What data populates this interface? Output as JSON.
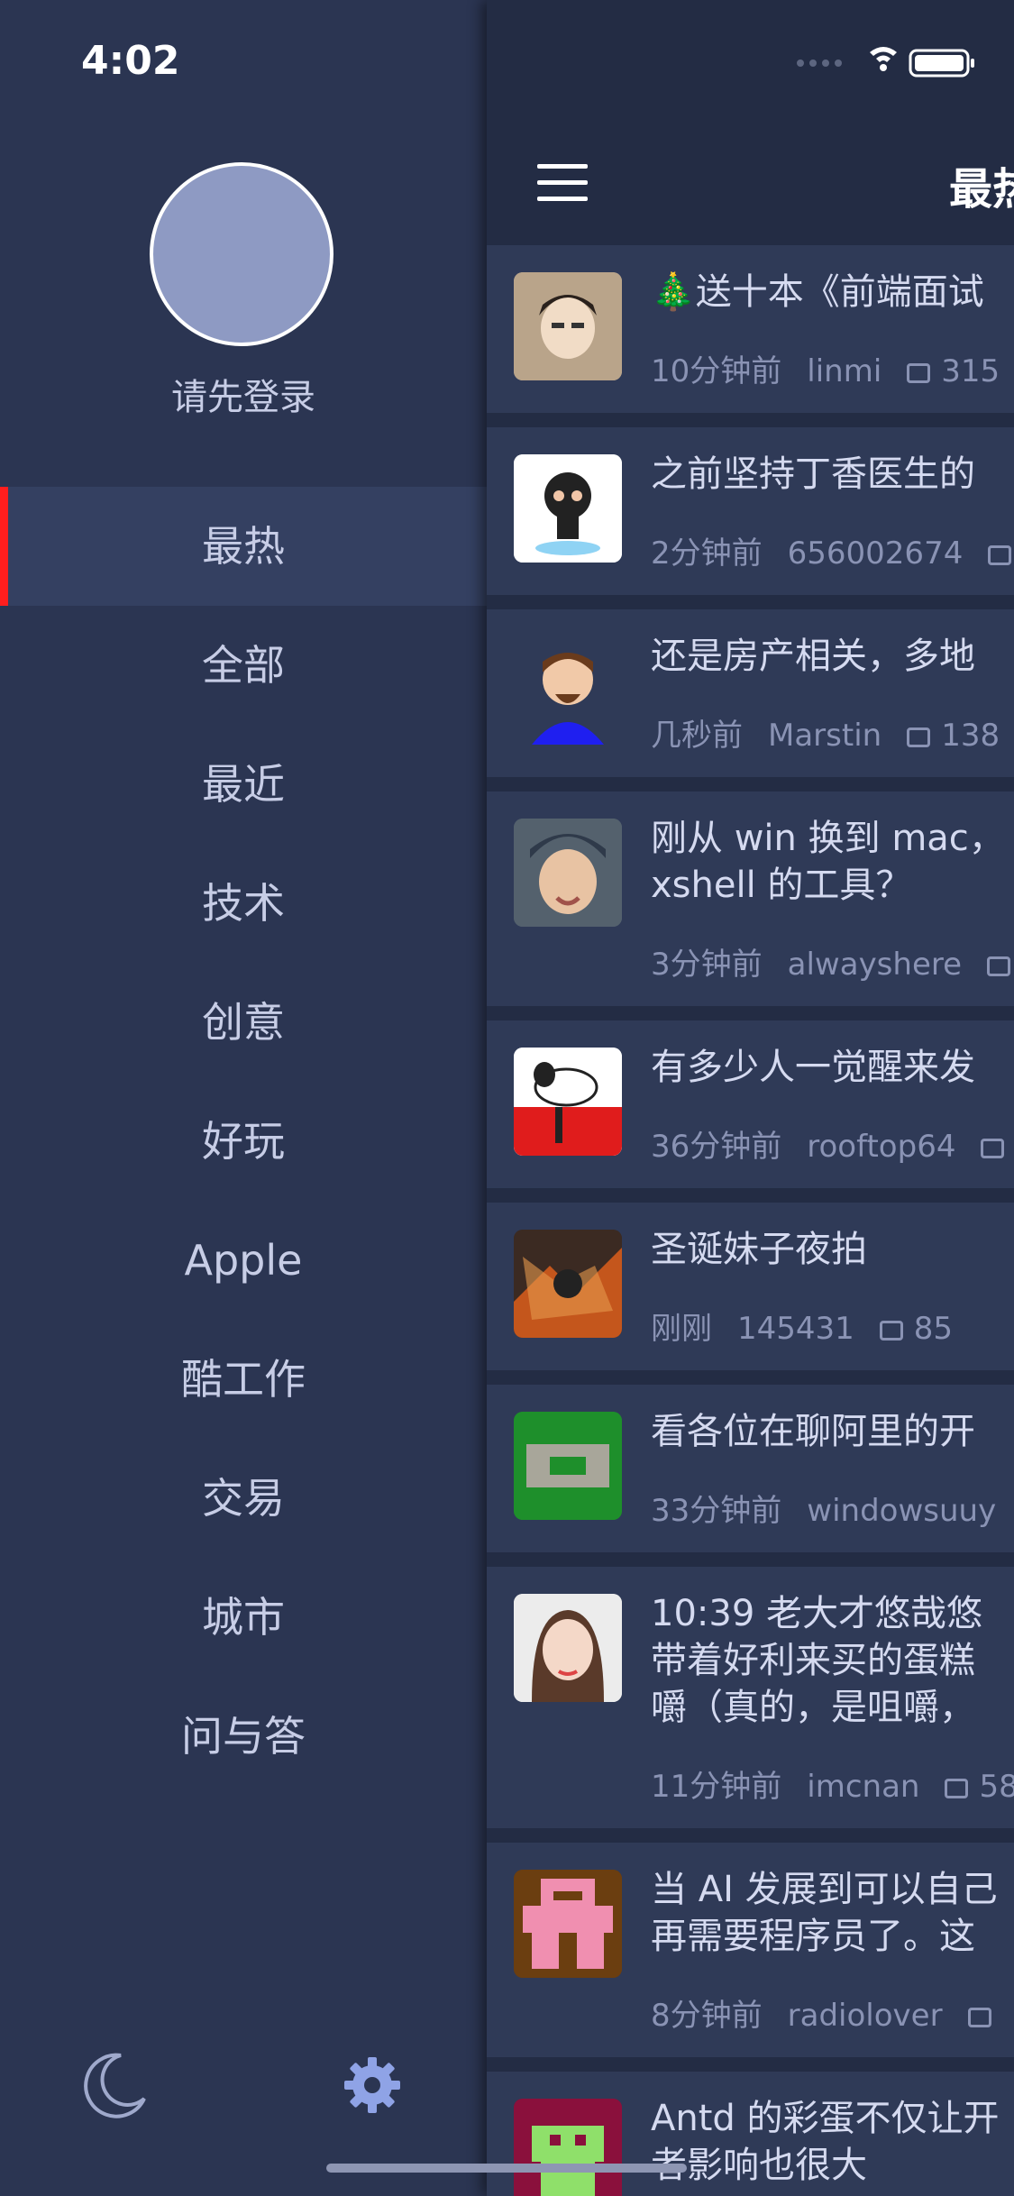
{
  "status_bar": {
    "time": "4:02"
  },
  "drawer": {
    "login_text": "请先登录",
    "menu": [
      {
        "label": "最热",
        "active": true
      },
      {
        "label": "全部"
      },
      {
        "label": "最近"
      },
      {
        "label": "技术"
      },
      {
        "label": "创意"
      },
      {
        "label": "好玩"
      },
      {
        "label": "Apple"
      },
      {
        "label": "酷工作"
      },
      {
        "label": "交易"
      },
      {
        "label": "城市"
      },
      {
        "label": "问与答"
      }
    ],
    "bottom_icons": [
      "moon-icon",
      "gear-icon"
    ]
  },
  "panel": {
    "nav_title": "最热",
    "topics": [
      {
        "title": "🎄送十本《前端面试",
        "time": "10分钟前",
        "user": "linmi",
        "comments": "315"
      },
      {
        "title": "之前坚持丁香医生的",
        "time": "2分钟前",
        "user": "656002674",
        "comments": ""
      },
      {
        "title": "还是房产相关，多地",
        "time": "几秒前",
        "user": "Marstin",
        "comments": "138"
      },
      {
        "title": "刚从 win 换到 mac，\nxshell 的工具？",
        "time": "3分钟前",
        "user": "alwayshere",
        "comments": ""
      },
      {
        "title": "有多少人一觉醒来发",
        "time": "36分钟前",
        "user": "rooftop64",
        "comments": ""
      },
      {
        "title": "圣诞妹子夜拍",
        "time": "刚刚",
        "user": "145431",
        "comments": "85"
      },
      {
        "title": "看各位在聊阿里的开",
        "time": "33分钟前",
        "user": "windowsuuy",
        "comments": ""
      },
      {
        "title": "10:39 老大才悠哉悠\n带着好利来买的蛋糕\n嚼（真的，是咀嚼，",
        "time": "11分钟前",
        "user": "imcnan",
        "comments": "58"
      },
      {
        "title": "当 AI 发展到可以自己\n再需要程序员了。这",
        "time": "8分钟前",
        "user": "radiolover",
        "comments": ""
      },
      {
        "title": "Antd 的彩蛋不仅让开\n者影响也很大",
        "time": "",
        "user": "",
        "comments": ""
      }
    ]
  },
  "colors": {
    "drawer_bg": "#2b3552",
    "panel_bg": "#232c44",
    "card_bg": "#2f3a57",
    "active_indicator": "#ff1e1e"
  }
}
